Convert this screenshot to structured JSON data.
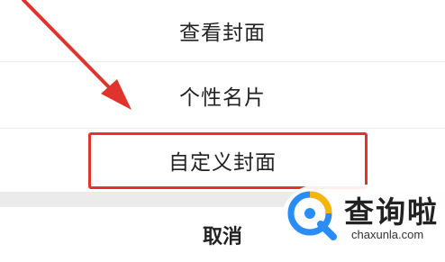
{
  "menu": {
    "items": [
      {
        "label": "查看封面"
      },
      {
        "label": "个性名片"
      },
      {
        "label": "自定义封面"
      }
    ],
    "cancel_label": "取消"
  },
  "annotation": {
    "arrow_color": "#e0332d",
    "box_color": "#e0332d"
  },
  "watermark": {
    "logo_icon": "magnifier-logo-icon",
    "text_cn": "查询啦",
    "text_en": "chaxunla.com",
    "logo_colors": [
      "#2a8cf5",
      "#f7b500"
    ]
  }
}
